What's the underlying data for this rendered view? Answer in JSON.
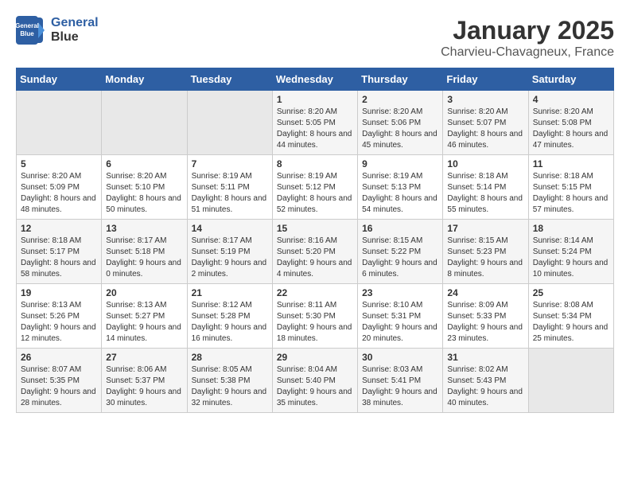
{
  "logo": {
    "line1": "General",
    "line2": "Blue"
  },
  "title": "January 2025",
  "location": "Charvieu-Chavagneux, France",
  "weekdays": [
    "Sunday",
    "Monday",
    "Tuesday",
    "Wednesday",
    "Thursday",
    "Friday",
    "Saturday"
  ],
  "weeks": [
    [
      {
        "day": "",
        "sunrise": "",
        "sunset": "",
        "daylight": ""
      },
      {
        "day": "",
        "sunrise": "",
        "sunset": "",
        "daylight": ""
      },
      {
        "day": "",
        "sunrise": "",
        "sunset": "",
        "daylight": ""
      },
      {
        "day": "1",
        "sunrise": "Sunrise: 8:20 AM",
        "sunset": "Sunset: 5:05 PM",
        "daylight": "Daylight: 8 hours and 44 minutes."
      },
      {
        "day": "2",
        "sunrise": "Sunrise: 8:20 AM",
        "sunset": "Sunset: 5:06 PM",
        "daylight": "Daylight: 8 hours and 45 minutes."
      },
      {
        "day": "3",
        "sunrise": "Sunrise: 8:20 AM",
        "sunset": "Sunset: 5:07 PM",
        "daylight": "Daylight: 8 hours and 46 minutes."
      },
      {
        "day": "4",
        "sunrise": "Sunrise: 8:20 AM",
        "sunset": "Sunset: 5:08 PM",
        "daylight": "Daylight: 8 hours and 47 minutes."
      }
    ],
    [
      {
        "day": "5",
        "sunrise": "Sunrise: 8:20 AM",
        "sunset": "Sunset: 5:09 PM",
        "daylight": "Daylight: 8 hours and 48 minutes."
      },
      {
        "day": "6",
        "sunrise": "Sunrise: 8:20 AM",
        "sunset": "Sunset: 5:10 PM",
        "daylight": "Daylight: 8 hours and 50 minutes."
      },
      {
        "day": "7",
        "sunrise": "Sunrise: 8:19 AM",
        "sunset": "Sunset: 5:11 PM",
        "daylight": "Daylight: 8 hours and 51 minutes."
      },
      {
        "day": "8",
        "sunrise": "Sunrise: 8:19 AM",
        "sunset": "Sunset: 5:12 PM",
        "daylight": "Daylight: 8 hours and 52 minutes."
      },
      {
        "day": "9",
        "sunrise": "Sunrise: 8:19 AM",
        "sunset": "Sunset: 5:13 PM",
        "daylight": "Daylight: 8 hours and 54 minutes."
      },
      {
        "day": "10",
        "sunrise": "Sunrise: 8:18 AM",
        "sunset": "Sunset: 5:14 PM",
        "daylight": "Daylight: 8 hours and 55 minutes."
      },
      {
        "day": "11",
        "sunrise": "Sunrise: 8:18 AM",
        "sunset": "Sunset: 5:15 PM",
        "daylight": "Daylight: 8 hours and 57 minutes."
      }
    ],
    [
      {
        "day": "12",
        "sunrise": "Sunrise: 8:18 AM",
        "sunset": "Sunset: 5:17 PM",
        "daylight": "Daylight: 8 hours and 58 minutes."
      },
      {
        "day": "13",
        "sunrise": "Sunrise: 8:17 AM",
        "sunset": "Sunset: 5:18 PM",
        "daylight": "Daylight: 9 hours and 0 minutes."
      },
      {
        "day": "14",
        "sunrise": "Sunrise: 8:17 AM",
        "sunset": "Sunset: 5:19 PM",
        "daylight": "Daylight: 9 hours and 2 minutes."
      },
      {
        "day": "15",
        "sunrise": "Sunrise: 8:16 AM",
        "sunset": "Sunset: 5:20 PM",
        "daylight": "Daylight: 9 hours and 4 minutes."
      },
      {
        "day": "16",
        "sunrise": "Sunrise: 8:15 AM",
        "sunset": "Sunset: 5:22 PM",
        "daylight": "Daylight: 9 hours and 6 minutes."
      },
      {
        "day": "17",
        "sunrise": "Sunrise: 8:15 AM",
        "sunset": "Sunset: 5:23 PM",
        "daylight": "Daylight: 9 hours and 8 minutes."
      },
      {
        "day": "18",
        "sunrise": "Sunrise: 8:14 AM",
        "sunset": "Sunset: 5:24 PM",
        "daylight": "Daylight: 9 hours and 10 minutes."
      }
    ],
    [
      {
        "day": "19",
        "sunrise": "Sunrise: 8:13 AM",
        "sunset": "Sunset: 5:26 PM",
        "daylight": "Daylight: 9 hours and 12 minutes."
      },
      {
        "day": "20",
        "sunrise": "Sunrise: 8:13 AM",
        "sunset": "Sunset: 5:27 PM",
        "daylight": "Daylight: 9 hours and 14 minutes."
      },
      {
        "day": "21",
        "sunrise": "Sunrise: 8:12 AM",
        "sunset": "Sunset: 5:28 PM",
        "daylight": "Daylight: 9 hours and 16 minutes."
      },
      {
        "day": "22",
        "sunrise": "Sunrise: 8:11 AM",
        "sunset": "Sunset: 5:30 PM",
        "daylight": "Daylight: 9 hours and 18 minutes."
      },
      {
        "day": "23",
        "sunrise": "Sunrise: 8:10 AM",
        "sunset": "Sunset: 5:31 PM",
        "daylight": "Daylight: 9 hours and 20 minutes."
      },
      {
        "day": "24",
        "sunrise": "Sunrise: 8:09 AM",
        "sunset": "Sunset: 5:33 PM",
        "daylight": "Daylight: 9 hours and 23 minutes."
      },
      {
        "day": "25",
        "sunrise": "Sunrise: 8:08 AM",
        "sunset": "Sunset: 5:34 PM",
        "daylight": "Daylight: 9 hours and 25 minutes."
      }
    ],
    [
      {
        "day": "26",
        "sunrise": "Sunrise: 8:07 AM",
        "sunset": "Sunset: 5:35 PM",
        "daylight": "Daylight: 9 hours and 28 minutes."
      },
      {
        "day": "27",
        "sunrise": "Sunrise: 8:06 AM",
        "sunset": "Sunset: 5:37 PM",
        "daylight": "Daylight: 9 hours and 30 minutes."
      },
      {
        "day": "28",
        "sunrise": "Sunrise: 8:05 AM",
        "sunset": "Sunset: 5:38 PM",
        "daylight": "Daylight: 9 hours and 32 minutes."
      },
      {
        "day": "29",
        "sunrise": "Sunrise: 8:04 AM",
        "sunset": "Sunset: 5:40 PM",
        "daylight": "Daylight: 9 hours and 35 minutes."
      },
      {
        "day": "30",
        "sunrise": "Sunrise: 8:03 AM",
        "sunset": "Sunset: 5:41 PM",
        "daylight": "Daylight: 9 hours and 38 minutes."
      },
      {
        "day": "31",
        "sunrise": "Sunrise: 8:02 AM",
        "sunset": "Sunset: 5:43 PM",
        "daylight": "Daylight: 9 hours and 40 minutes."
      },
      {
        "day": "",
        "sunrise": "",
        "sunset": "",
        "daylight": ""
      }
    ]
  ]
}
